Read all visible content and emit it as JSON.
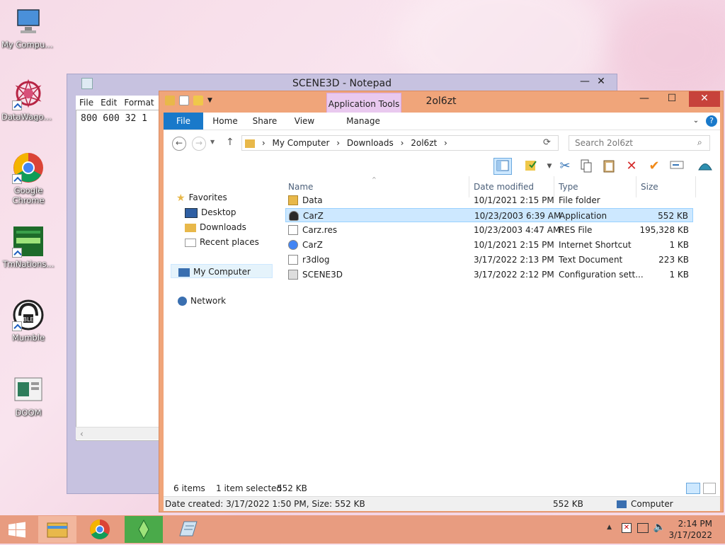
{
  "desktop": {
    "icons": [
      {
        "label": "My Computer",
        "icon": "computer-icon"
      },
      {
        "label": "DataWagon...",
        "icon": "datawagon-icon"
      },
      {
        "label": "Google Chrome",
        "icon": "chrome-icon"
      },
      {
        "label": "TmNations...",
        "icon": "tmnations-icon"
      },
      {
        "label": "Mumble",
        "icon": "mumble-icon"
      },
      {
        "label": "DOOM",
        "icon": "doom-icon"
      }
    ]
  },
  "notepad": {
    "title": "SCENE3D - Notepad",
    "menu": [
      "File",
      "Edit",
      "Format"
    ],
    "content": "800 600 32 1",
    "minimize": "—",
    "close": "✕"
  },
  "explorer": {
    "title": "2ol6zt",
    "context_tab": "Application Tools",
    "tabs": {
      "file": "File",
      "home": "Home",
      "share": "Share",
      "view": "View",
      "manage": "Manage"
    },
    "breadcrumb": [
      "My Computer",
      "Downloads",
      "2ol6zt"
    ],
    "search_placeholder": "Search 2ol6zt",
    "nav": {
      "favorites": "Favorites",
      "desktop": "Desktop",
      "downloads": "Downloads",
      "recent": "Recent places",
      "computer": "My Computer",
      "network": "Network"
    },
    "columns": {
      "name": "Name",
      "date": "Date modified",
      "type": "Type",
      "size": "Size"
    },
    "files": [
      {
        "name": "Data",
        "date": "10/1/2021 2:15 PM",
        "type": "File folder",
        "size": "",
        "icon": "folder-icon",
        "color": "#e8b84a"
      },
      {
        "name": "CarZ",
        "date": "10/23/2003 6:39 AM",
        "type": "Application",
        "size": "552 KB",
        "icon": "application-icon",
        "color": "#2a2a2a"
      },
      {
        "name": "Carz.res",
        "date": "10/23/2003 4:47 AM",
        "type": "RES File",
        "size": "195,328 KB",
        "icon": "file-icon",
        "color": "#ffffff"
      },
      {
        "name": "CarZ",
        "date": "10/1/2021 2:15 PM",
        "type": "Internet Shortcut",
        "size": "1 KB",
        "icon": "internet-shortcut-icon",
        "color": "#4285f4"
      },
      {
        "name": "r3dlog",
        "date": "3/17/2022 2:13 PM",
        "type": "Text Document",
        "size": "223 KB",
        "icon": "text-document-icon",
        "color": "#ffffff"
      },
      {
        "name": "SCENE3D",
        "date": "3/17/2022 2:12 PM",
        "type": "Configuration sett...",
        "size": "1 KB",
        "icon": "config-file-icon",
        "color": "#dddddd"
      }
    ],
    "status": {
      "items": "6 items",
      "selected": "1 item selected",
      "selected_size": "552 KB"
    },
    "details": {
      "text": "Date created: 3/17/2022 1:50 PM, Size: 552 KB",
      "size": "552 KB",
      "location": "Computer"
    }
  },
  "taskbar": {
    "time": "2:14 PM",
    "date": "3/17/2022"
  },
  "colors": {
    "accent": "#1979ca",
    "explorer_frame": "#f0a57a",
    "taskbar": "#e89c80",
    "selection": "#cde8ff"
  }
}
